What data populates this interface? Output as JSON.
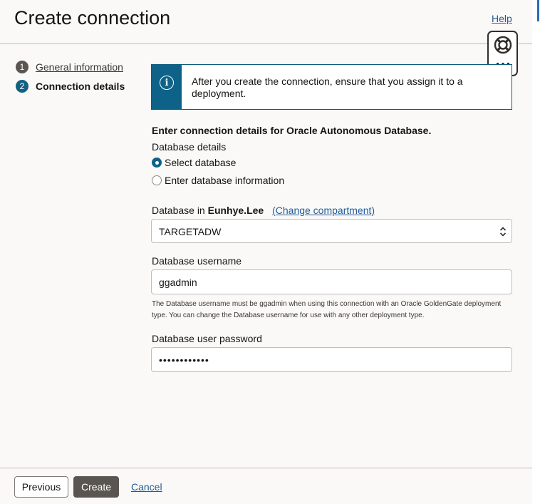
{
  "header": {
    "title": "Create connection",
    "help_label": "Help",
    "help_widget_icons": [
      "lifebuoy-icon",
      "grid-dots-icon"
    ]
  },
  "steps": [
    {
      "number": "1",
      "label": "General information",
      "state": "completed"
    },
    {
      "number": "2",
      "label": "Connection details",
      "state": "current"
    }
  ],
  "info_banner": {
    "icon": "info-icon",
    "text": "After you create the connection, ensure that you assign it to a deployment."
  },
  "form": {
    "section_heading": "Enter connection details for Oracle Autonomous Database.",
    "database_details_label": "Database details",
    "radio_options": [
      {
        "label": "Select database",
        "checked": true
      },
      {
        "label": "Enter database information",
        "checked": false
      }
    ],
    "database_in_prefix": "Database in",
    "compartment_name": "Eunhye.Lee",
    "change_compartment_link": "(Change compartment)",
    "database_select_value": "TARGETADW",
    "username_label": "Database username",
    "username_value": "ggadmin",
    "username_helper": "The Database username must be ggadmin when using this connection with an Oracle GoldenGate deployment type. You can change the Database username for use with any other deployment type.",
    "password_label": "Database user password",
    "password_value": "••••••••••••"
  },
  "footer": {
    "previous_label": "Previous",
    "create_label": "Create",
    "cancel_label": "Cancel"
  },
  "colors": {
    "accent": "#0e6288",
    "link": "#1f5c99",
    "primary_button": "#5a5550"
  }
}
